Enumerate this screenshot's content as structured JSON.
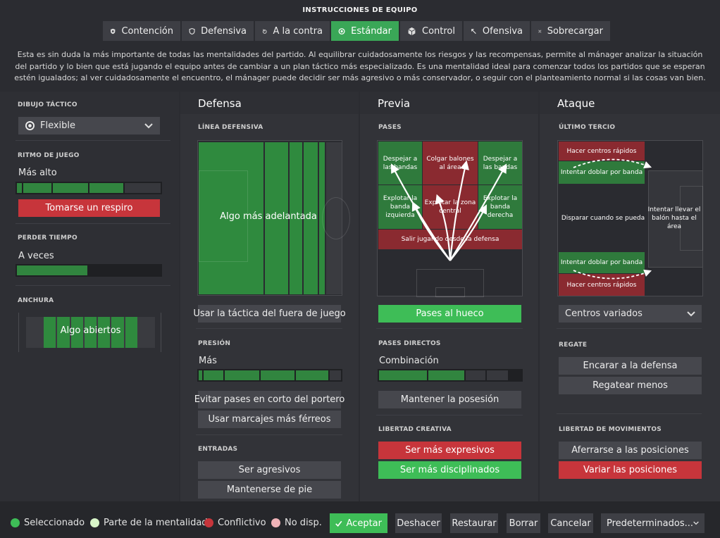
{
  "header": {
    "title": "INSTRUCCIONES DE EQUIPO",
    "tabs": [
      {
        "label": "Contención",
        "icon": "shield-lock-icon"
      },
      {
        "label": "Defensiva",
        "icon": "shield-icon"
      },
      {
        "label": "A la contra",
        "icon": "counter-icon"
      },
      {
        "label": "Estándar",
        "icon": "balanced-icon",
        "selected": true
      },
      {
        "label": "Control",
        "icon": "cube-icon"
      },
      {
        "label": "Ofensiva",
        "icon": "attack-arrow-icon"
      },
      {
        "label": "Sobrecargar",
        "icon": "overload-icon"
      }
    ],
    "description": "Esta es sin duda la más importante de todas las mentalidades del partido. Al equilibrar cuidadosamente los riesgos y las recompensas, permite al mánager analizar la situación del partido y lo bien que está jugando el equipo antes de cambiar a un plan táctico más especializado. Es una mentalidad ideal para comenzar todos los partidos que se esperan estén igualados; al ver cuidadosamente el encuentro, el mánager puede decidir ser más agresivo o más conservador, o seguir con el planteamiento normal si las cosas van bien."
  },
  "left": {
    "formation_label": "DIBUJO TÁCTICO",
    "formation_value": "Flexible",
    "tempo_label": "RITMO DE JUEGO",
    "tempo_value": "Más alto",
    "tempo_level": 0.8,
    "tempo_button": "Tomarse un respiro",
    "timewasting_label": "PERDER TIEMPO",
    "timewasting_value": "A veces",
    "timewasting_level": 0.5,
    "width_label": "ANCHURA",
    "width_value": "Algo abiertos"
  },
  "defense": {
    "heading": "Defensa",
    "line_label": "LÍNEA DEFENSIVA",
    "line_value": "Algo más adelantada",
    "offside_button": "Usar la táctica del fuera de juego",
    "press_label": "PRESIÓN",
    "press_value": "Más",
    "press_level": 0.8,
    "buttons": [
      "Evitar pases en corto del portero",
      "Usar marcajes más férreos"
    ],
    "tackle_label": "ENTRADAS",
    "tackle_buttons": [
      "Ser agresivos",
      "Mantenerse de pie"
    ]
  },
  "build": {
    "heading": "Previa",
    "passes_label": "PASES",
    "cells": {
      "clear_left": "Despejar a las bandas",
      "cross_area": "Colgar balones al área",
      "clear_right": "Despejar a las bandas",
      "exploit_left": "Explotar la banda izquierda",
      "exploit_center": "Explotar la zona central",
      "exploit_right": "Explotar la banda derecha",
      "play_out": "Salir jugando desde la defensa"
    },
    "through_button": "Pases al hueco",
    "direct_label": "PASES DIRECTOS",
    "direct_value": "Combinación",
    "direct_level": 0.6,
    "possession_button": "Mantener la posesión",
    "creative_label": "LIBERTAD CREATIVA",
    "expressive_button": "Ser más expresivos",
    "disciplined_button": "Ser más disciplinados"
  },
  "attack": {
    "heading": "Ataque",
    "final_third_label": "ÚLTIMO TERCIO",
    "cells": {
      "cross_top": "Hacer centros rápidos",
      "overlap_top": "Intentar doblar por banda",
      "shoot": "Disparar cuando se pueda",
      "work_ball": "Intentar llevar el balón hasta el área",
      "overlap_bottom": "Intentar doblar por banda",
      "cross_bottom": "Hacer centros rápidos"
    },
    "cross_select": "Centros variados",
    "dribble_label": "REGATE",
    "dribble_buttons": [
      "Encarar a la defensa",
      "Regatear menos"
    ],
    "movement_label": "LIBERTAD DE MOVIMIENTOS",
    "movement_buttons": [
      "Aferrarse a las posiciones",
      "Variar las posiciones"
    ]
  },
  "footer": {
    "legend": [
      {
        "label": "Seleccionado",
        "color": "#3ebd57"
      },
      {
        "label": "Parte de la mentalidad",
        "color": "#d8f5c8"
      },
      {
        "label": "Conflictivo",
        "color": "#c7353b"
      },
      {
        "label": "No disp.",
        "color": "#f0b3b8"
      }
    ],
    "accept": "Aceptar",
    "undo": "Deshacer",
    "restore": "Restaurar",
    "delete": "Borrar",
    "cancel": "Cancelar",
    "presets": "Predeterminados..."
  }
}
